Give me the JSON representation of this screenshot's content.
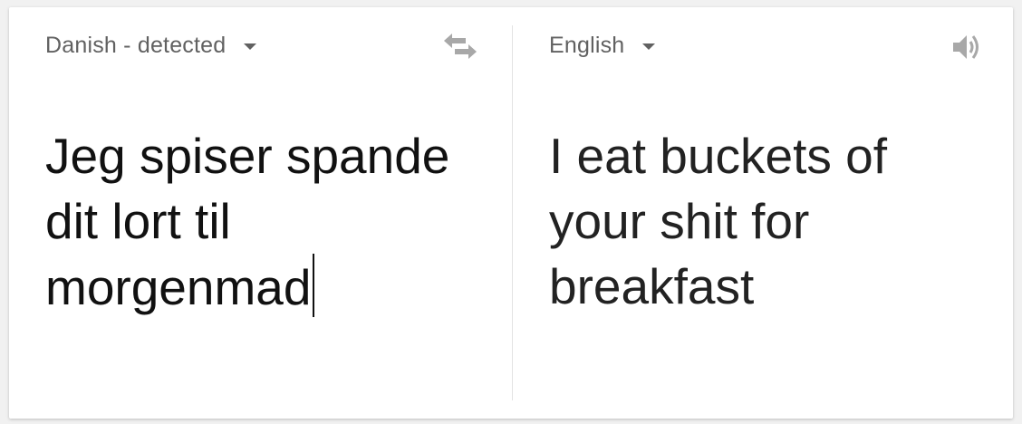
{
  "source": {
    "language_label": "Danish - detected",
    "text": "Jeg spiser spande\ndit lort til\nmorgenmad"
  },
  "target": {
    "language_label": "English",
    "text": "I eat buckets of\nyour shit for\nbreakfast"
  },
  "icons": {
    "swap": "swap-languages-icon",
    "speaker": "speaker-icon",
    "dropdown": "caret-down-icon"
  },
  "colors": {
    "label": "#616161",
    "icon": "#9e9e9e",
    "text": "#111111"
  }
}
